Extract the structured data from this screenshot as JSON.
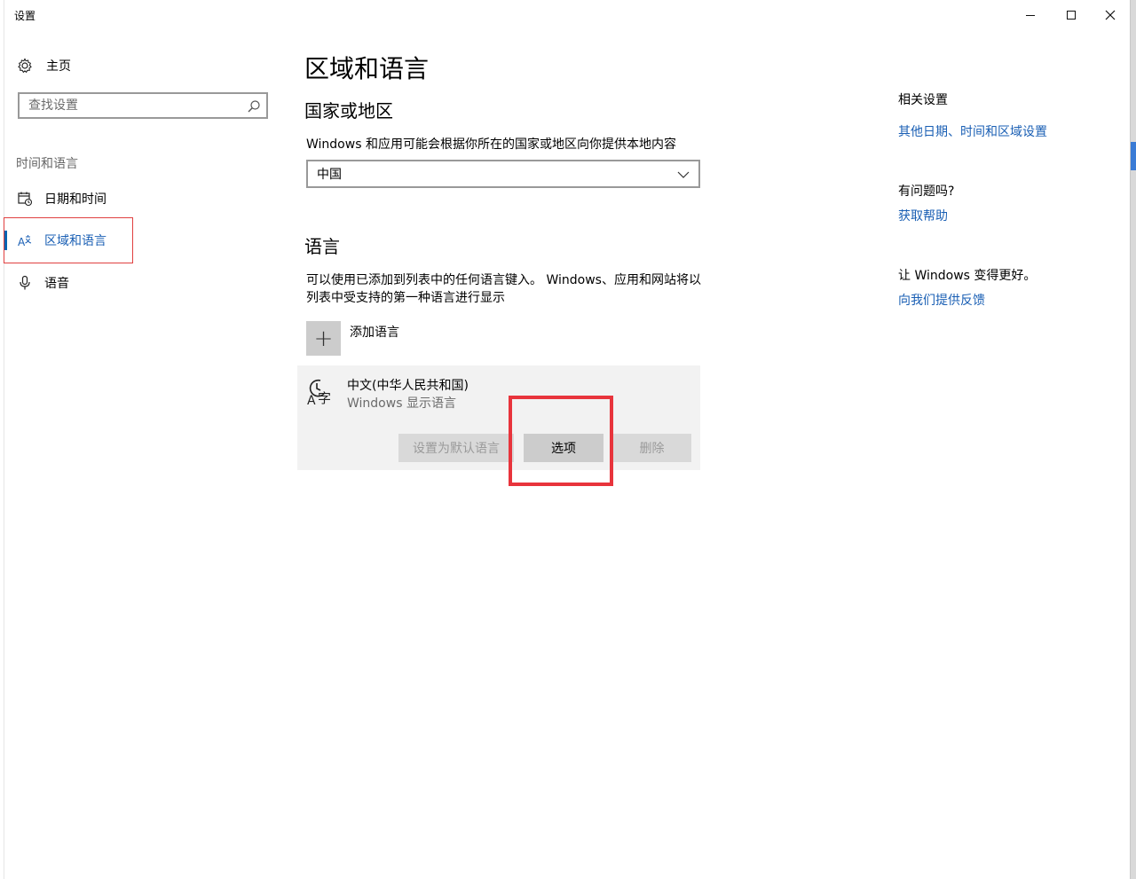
{
  "window": {
    "title": "设置",
    "minimize_glyph": "—",
    "maximize_glyph": "☐",
    "close_glyph": "✕"
  },
  "sidebar": {
    "home_label": "主页",
    "search_placeholder": "查找设置",
    "group_label": "时间和语言",
    "items": [
      {
        "label": "日期和时间",
        "icon": "calendar-clock-icon"
      },
      {
        "label": "区域和语言",
        "icon": "region-language-icon",
        "selected": true
      },
      {
        "label": "语音",
        "icon": "microphone-icon"
      }
    ]
  },
  "main": {
    "title": "区域和语言",
    "country_section": {
      "title": "国家或地区",
      "description": "Windows 和应用可能会根据你所在的国家或地区向你提供本地内容",
      "selected_value": "中国"
    },
    "language_section": {
      "title": "语言",
      "description": "可以使用已添加到列表中的任何语言键入。 Windows、应用和网站将以列表中受支持的第一种语言进行显示",
      "add_label": "添加语言",
      "plus_glyph": "+",
      "language": {
        "name": "中文(中华人民共和国)",
        "subtitle": "Windows 显示语言",
        "set_default_label": "设置为默认语言",
        "options_label": "选项",
        "remove_label": "删除"
      }
    }
  },
  "right_panel": {
    "related_heading": "相关设置",
    "related_link": "其他日期、时间和区域设置",
    "question_heading": "有问题吗?",
    "question_link": "获取帮助",
    "better_heading": "让 Windows 变得更好。",
    "better_link": "向我们提供反馈"
  },
  "colors": {
    "accent": "#0063b1",
    "link": "#1a5fb4",
    "highlight_red": "#e8343c"
  }
}
